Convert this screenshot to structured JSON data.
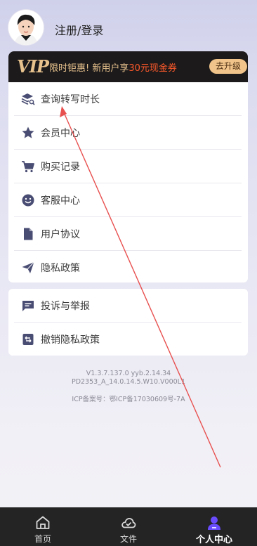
{
  "header": {
    "login_text": "注册/登录"
  },
  "vip": {
    "logo": "VIP",
    "promo_prefix": "限时钜惠! 新用户享",
    "promo_highlight": "30元现金券",
    "upgrade_button": "去升级"
  },
  "menu_main": [
    {
      "label": "查询转写时长",
      "icon": "stack-search-icon"
    },
    {
      "label": "会员中心",
      "icon": "star-icon"
    },
    {
      "label": "购买记录",
      "icon": "cart-icon"
    },
    {
      "label": "客服中心",
      "icon": "smile-icon"
    },
    {
      "label": "用户协议",
      "icon": "document-icon"
    },
    {
      "label": "隐私政策",
      "icon": "send-icon"
    }
  ],
  "menu_secondary": [
    {
      "label": "投诉与举报",
      "icon": "chat-icon"
    },
    {
      "label": "撤销隐私政策",
      "icon": "revoke-doc-icon"
    }
  ],
  "footer": {
    "version_line1": "V1.3.7.137.0  yyb.2.14.34",
    "version_line2": "PD2353_A_14.0.14.5.W10.V000L1",
    "icp_label": "ICP备案号：",
    "icp_value": "鄂ICP备17030609号-7A"
  },
  "tabbar": {
    "tabs": [
      {
        "label": "首页",
        "icon": "home-icon",
        "active": false
      },
      {
        "label": "文件",
        "icon": "cloud-icon",
        "active": false
      },
      {
        "label": "个人中心",
        "icon": "user-icon",
        "active": true
      }
    ]
  },
  "colors": {
    "vip_gold": "#e7c28d",
    "vip_highlight": "#ff5a2b",
    "icon_color": "#4a4d73",
    "tabbar_bg": "#242424",
    "active_tab_icon": "#6a4cff"
  }
}
